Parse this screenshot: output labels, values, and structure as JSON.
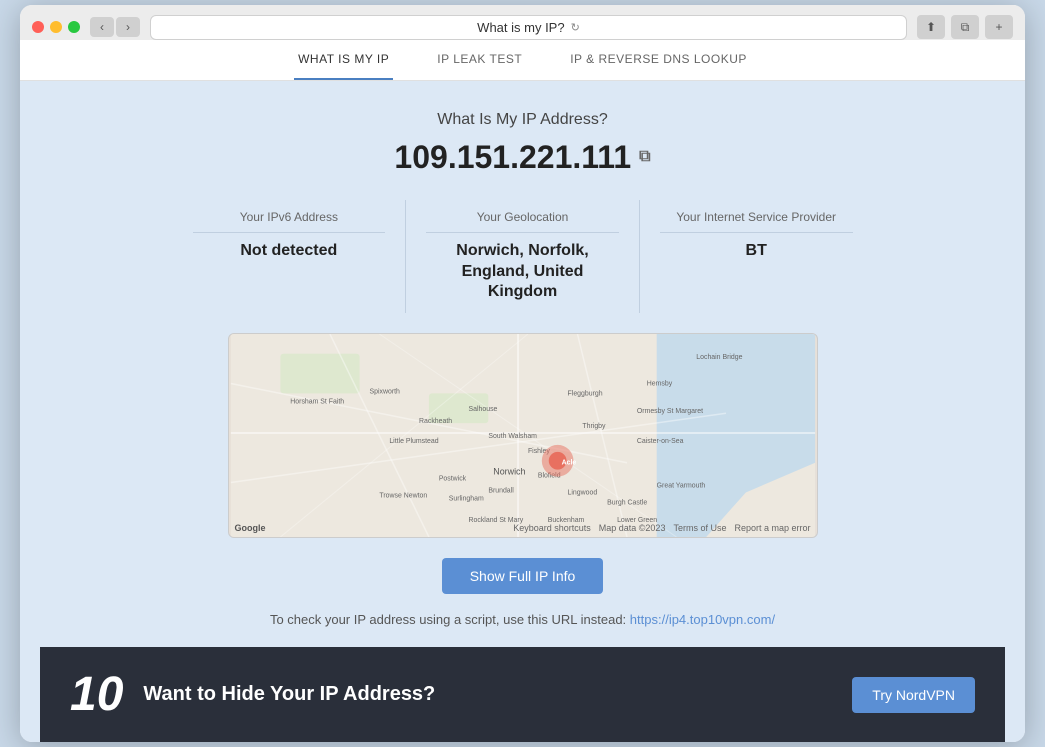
{
  "browser": {
    "address_bar_text": "What is my IP?",
    "nav_back_label": "‹",
    "nav_forward_label": "›",
    "reload_label": "↻",
    "action_share": "⬆",
    "action_tabs": "⧉",
    "action_add": "+"
  },
  "site_nav": {
    "tabs": [
      {
        "id": "what-is-my-ip",
        "label": "WHAT IS MY IP",
        "active": true
      },
      {
        "id": "ip-leak-test",
        "label": "IP LEAK TEST",
        "active": false
      },
      {
        "id": "ip-reverse-dns",
        "label": "IP & REVERSE DNS LOOKUP",
        "active": false
      }
    ]
  },
  "page": {
    "title": "What Is My IP Address?",
    "ip_address": "109.151.221.111",
    "copy_icon": "⧉",
    "info_cards": [
      {
        "label": "Your IPv6 Address",
        "value": "Not detected"
      },
      {
        "label": "Your Geolocation",
        "value": "Norwich, Norfolk, England, United Kingdom"
      },
      {
        "label": "Your Internet Service Provider",
        "value": "BT"
      }
    ],
    "map": {
      "google_label": "Google",
      "keyboard_shortcuts": "Keyboard shortcuts",
      "map_data": "Map data ©2023",
      "terms": "Terms of Use",
      "report": "Report a map error"
    },
    "show_full_btn": "Show Full IP Info",
    "script_text": "To check your IP address using a script, use this URL instead:",
    "script_url": "https://ip4.top10vpn.com/",
    "hide_ip_banner": {
      "logo_text": "10",
      "title": "Want to Hide Your IP Address?",
      "btn_label": "Try NordVPN"
    }
  },
  "colors": {
    "accent": "#5b8fd4",
    "map_pin": "#e87060",
    "dark_bg": "#2a2f3a"
  }
}
